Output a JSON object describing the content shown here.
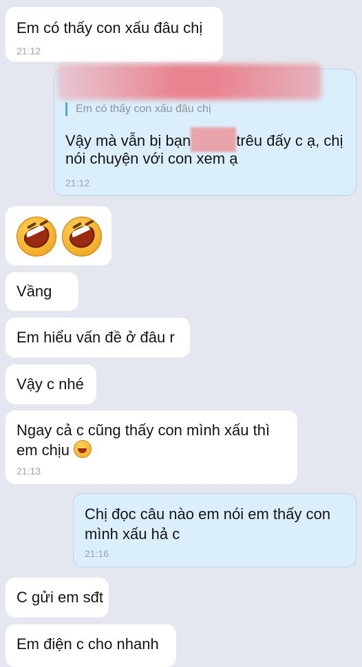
{
  "messages": {
    "m1": {
      "text": "Em có thấy con xấu đâu chị",
      "time": "21:12"
    },
    "m2": {
      "quote": "Em có thấy con xấu đâu chị",
      "line1_a": "Vậy mà vẫn bị bạn",
      "line1_b": "trêu đấy c ạ, chị",
      "line2": "nói chuyện với con xem ạ",
      "time": "21:12"
    },
    "m3": {
      "emoji": [
        "laughing-crying-face-icon",
        "laughing-crying-face-icon"
      ]
    },
    "m4": {
      "text": "Vầng"
    },
    "m5": {
      "text": "Em hiểu vấn đề ở đâu r"
    },
    "m6": {
      "text": "Vậy c nhé"
    },
    "m7": {
      "line1": "Ngay cả c cũng thấy con mình xấu thì",
      "line2": "em chịu",
      "time": "21:13"
    },
    "m8": {
      "line1": "Chị đọc câu nào em nói em thấy con",
      "line2": "mình xấu hả c",
      "time": "21:16"
    },
    "m9": {
      "text": "C gửi em sđt"
    },
    "m10": {
      "text": "Em điện c cho nhanh"
    }
  }
}
